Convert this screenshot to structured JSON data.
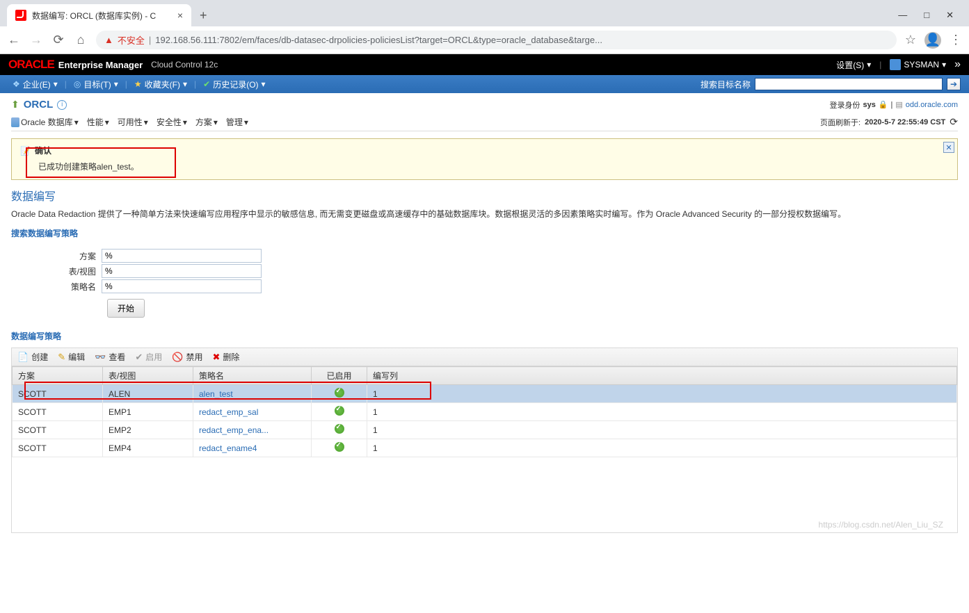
{
  "browser": {
    "tab_title": "数据编写: ORCL (数据库实例) - C",
    "url_insecure": "不安全",
    "url": "192.168.56.111:7802/em/faces/db-datasec-drpolicies-policiesList?target=ORCL&type=oracle_database&targe..."
  },
  "em_header": {
    "brand": "ORACLE",
    "title": "Enterprise Manager",
    "subtitle": "Cloud Control 12c",
    "settings": "设置(S)",
    "user": "SYSMAN"
  },
  "global_nav": {
    "enterprise": "企业(E)",
    "targets": "目标(T)",
    "favorites": "收藏夹(F)",
    "history": "历史记录(O)",
    "search_label": "搜索目标名称"
  },
  "target": {
    "name": "ORCL",
    "login_label": "登录身份",
    "login_user": "sys",
    "host": "odd.oracle.com"
  },
  "sub_nav": {
    "oracle_db": "Oracle 数据库",
    "perf": "性能",
    "avail": "可用性",
    "sec": "安全性",
    "schema": "方案",
    "admin": "管理"
  },
  "refresh": {
    "label": "页面刷新于:",
    "time": "2020-5-7 22:55:49 CST"
  },
  "confirm": {
    "title": "确认",
    "message": "已成功创建策略alen_test。"
  },
  "section": {
    "title": "数据编写",
    "desc": "Oracle Data Redaction 提供了一种简单方法来快速编写应用程序中显示的敏感信息, 而无需变更磁盘或高速缓存中的基础数据库块。数据根据灵活的多因素策略实时编写。作为 Oracle Advanced Security 的一部分授权数据编写。",
    "search_title": "搜索数据编写策略",
    "policies_title": "数据编写策略"
  },
  "search_form": {
    "schema_label": "方案",
    "schema_value": "%",
    "table_label": "表/视图",
    "table_value": "%",
    "policy_label": "策略名",
    "policy_value": "%",
    "go": "开始"
  },
  "toolbar": {
    "create": "创建",
    "edit": "编辑",
    "view": "查看",
    "enable": "启用",
    "disable": "禁用",
    "delete": "删除"
  },
  "table": {
    "cols": {
      "schema": "方案",
      "table": "表/视图",
      "policy": "策略名",
      "enabled": "已启用",
      "redacted": "编写列"
    },
    "rows": [
      {
        "schema": "SCOTT",
        "table": "ALEN",
        "policy": "alen_test",
        "enabled": true,
        "redacted": "1",
        "selected": true
      },
      {
        "schema": "SCOTT",
        "table": "EMP1",
        "policy": "redact_emp_sal",
        "enabled": true,
        "redacted": "1",
        "selected": false
      },
      {
        "schema": "SCOTT",
        "table": "EMP2",
        "policy": "redact_emp_ena...",
        "enabled": true,
        "redacted": "1",
        "selected": false
      },
      {
        "schema": "SCOTT",
        "table": "EMP4",
        "policy": "redact_ename4",
        "enabled": true,
        "redacted": "1",
        "selected": false
      }
    ]
  }
}
